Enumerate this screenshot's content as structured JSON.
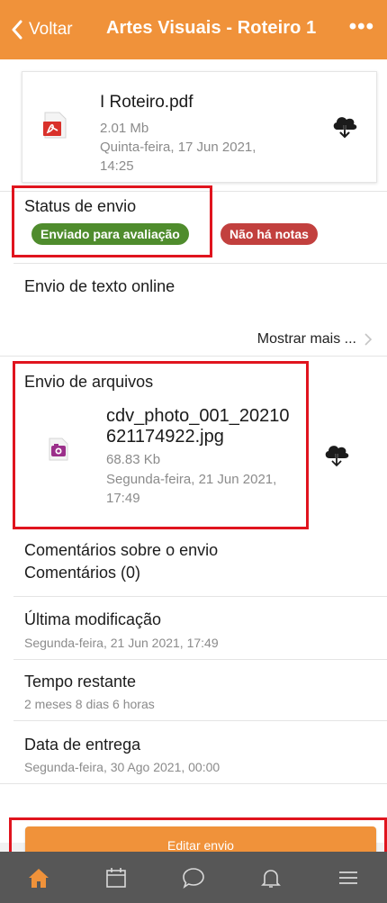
{
  "header": {
    "back_label": "Voltar",
    "title": "Artes Visuais - Roteiro 1",
    "more_label": "•••"
  },
  "attachment": {
    "name": "I Roteiro.pdf",
    "size": "2.01 Mb",
    "date_line1": "Quinta-feira, 17 Jun 2021,",
    "date_line2": "14:25",
    "icon": "pdf-file-icon"
  },
  "status": {
    "label": "Status de envio",
    "badge_submitted": "Enviado para avaliação",
    "badge_grades": "Não há notas",
    "badge_submitted_color": "#4f8c2d",
    "badge_grades_color": "#c2403e"
  },
  "online_text": {
    "label": "Envio de texto online",
    "show_more": "Mostrar mais ..."
  },
  "file_submission": {
    "label": "Envio de arquivos",
    "name_line1": "cdv_photo_001_20210",
    "name_line2": "621174922.jpg",
    "size": "68.83 Kb",
    "date_line1": "Segunda-feira, 21 Jun 2021,",
    "date_line2": "17:49",
    "icon": "image-file-icon"
  },
  "comments": {
    "label": "Comentários sobre o envio",
    "count_label": "Comentários (0)"
  },
  "last_modified": {
    "label": "Última modificação",
    "value": "Segunda-feira, 21 Jun 2021, 17:49"
  },
  "time_remaining": {
    "label": "Tempo restante",
    "value": "2 meses 8 dias 6 horas"
  },
  "due_date": {
    "label": "Data de entrega",
    "value": "Segunda-feira, 30 Ago 2021, 00:00"
  },
  "edit_button": "Editar envio",
  "tabbar": {
    "items": [
      "home-icon",
      "calendar-icon",
      "chat-icon",
      "bell-icon",
      "menu-icon"
    ]
  },
  "colors": {
    "accent": "#f0923a",
    "tabbar": "#575757",
    "highlight": "#e0141e"
  }
}
